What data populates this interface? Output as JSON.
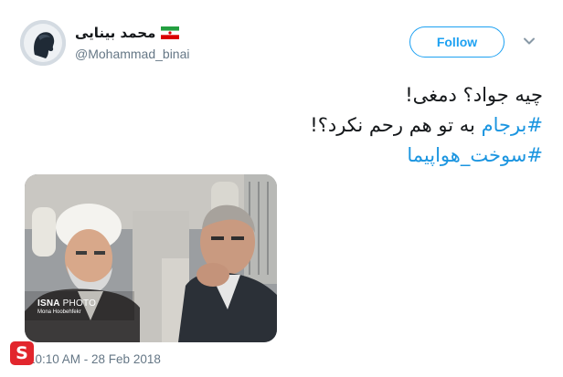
{
  "tweet": {
    "author": {
      "display_name": "محمد بینایی",
      "handle": "@Mohammad_binai",
      "flag": "iran-flag-icon"
    },
    "follow_label": "Follow",
    "menu_icon": "chevron-down-icon",
    "text_lines": [
      {
        "plain": "چیه جواد؟ دمغی!"
      },
      {
        "hashtag": "#برجام",
        "plain": " به تو هم رحم نکرد؟!"
      },
      {
        "hashtag": "#سوخت_هواپیما"
      }
    ],
    "photo": {
      "credit_brand_bold": "ISNA",
      "credit_brand_light": " PHOTO",
      "credit_sub": "Mona Hoobehfekr"
    },
    "timestamp": "10:10 AM - 28 Feb 2018"
  },
  "watermark": {
    "letter": "S",
    "color": "#e2262d"
  },
  "colors": {
    "accent": "#1da1f2",
    "hashtag": "#1b95e0",
    "secondary_text": "#657786",
    "primary_text": "#14171a"
  }
}
